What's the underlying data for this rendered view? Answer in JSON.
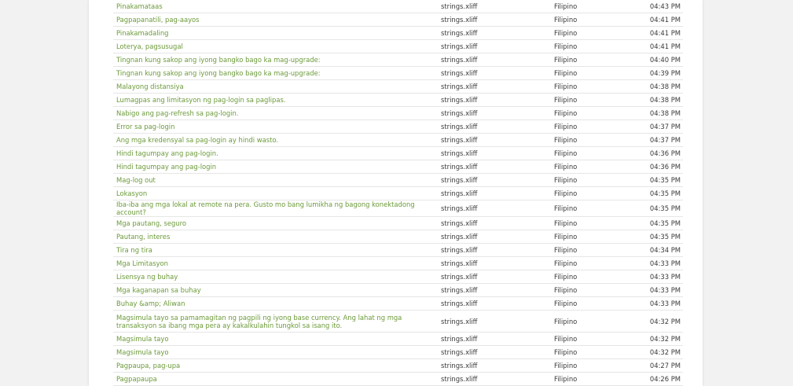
{
  "table": {
    "rows": [
      {
        "text": "Pinakamataas",
        "file": "strings.xliff",
        "language": "Filipino",
        "time": "04:43 PM"
      },
      {
        "text": "Pagpapanatili, pag-aayos",
        "file": "strings.xliff",
        "language": "Filipino",
        "time": "04:41 PM"
      },
      {
        "text": "Pinakamadaling",
        "file": "strings.xliff",
        "language": "Filipino",
        "time": "04:41 PM"
      },
      {
        "text": "Loterya, pagsusugal",
        "file": "strings.xliff",
        "language": "Filipino",
        "time": "04:41 PM"
      },
      {
        "text": "Tingnan kung sakop ang iyong bangko bago ka mag-upgrade:",
        "file": "strings.xliff",
        "language": "Filipino",
        "time": "04:40 PM"
      },
      {
        "text": "Tingnan kung sakop ang iyong bangko bago ka mag-upgrade:",
        "file": "strings.xliff",
        "language": "Filipino",
        "time": "04:39 PM"
      },
      {
        "text": "Malayong distansiya",
        "file": "strings.xliff",
        "language": "Filipino",
        "time": "04:38 PM"
      },
      {
        "text": "Lumagpas ang limitasyon ng pag-login sa paglipas.",
        "file": "strings.xliff",
        "language": "Filipino",
        "time": "04:38 PM"
      },
      {
        "text": "Nabigo ang pag-refresh sa pag-login.",
        "file": "strings.xliff",
        "language": "Filipino",
        "time": "04:38 PM"
      },
      {
        "text": "Error sa pag-login",
        "file": "strings.xliff",
        "language": "Filipino",
        "time": "04:37 PM"
      },
      {
        "text": "Ang mga kredensyal sa pag-login ay hindi wasto.",
        "file": "strings.xliff",
        "language": "Filipino",
        "time": "04:37 PM"
      },
      {
        "text": "Hindi tagumpay ang pag-login.",
        "file": "strings.xliff",
        "language": "Filipino",
        "time": "04:36 PM"
      },
      {
        "text": "Hindi tagumpay ang pag-login",
        "file": "strings.xliff",
        "language": "Filipino",
        "time": "04:36 PM"
      },
      {
        "text": "Mag-log out",
        "file": "strings.xliff",
        "language": "Filipino",
        "time": "04:35 PM"
      },
      {
        "text": "Lokasyon",
        "file": "strings.xliff",
        "language": "Filipino",
        "time": "04:35 PM"
      },
      {
        "text": "Iba-iba ang mga lokal at remote na pera. Gusto mo bang lumikha ng bagong konektadong account?",
        "file": "strings.xliff",
        "language": "Filipino",
        "time": "04:35 PM"
      },
      {
        "text": "Mga pautang, seguro",
        "file": "strings.xliff",
        "language": "Filipino",
        "time": "04:35 PM"
      },
      {
        "text": "Pautang, interes",
        "file": "strings.xliff",
        "language": "Filipino",
        "time": "04:35 PM"
      },
      {
        "text": "Tira ng tira",
        "file": "strings.xliff",
        "language": "Filipino",
        "time": "04:34 PM"
      },
      {
        "text": "Mga Limitasyon",
        "file": "strings.xliff",
        "language": "Filipino",
        "time": "04:33 PM"
      },
      {
        "text": "Lisensya ng buhay",
        "file": "strings.xliff",
        "language": "Filipino",
        "time": "04:33 PM"
      },
      {
        "text": "Mga kaganapan sa buhay",
        "file": "strings.xliff",
        "language": "Filipino",
        "time": "04:33 PM"
      },
      {
        "text": "Buhay &amp; Aliwan",
        "file": "strings.xliff",
        "language": "Filipino",
        "time": "04:33 PM"
      },
      {
        "text": "Magsimula tayo sa pamamagitan ng pagpili ng iyong base currency. Ang lahat ng mga transaksyon sa ibang mga pera ay kakalkulahin tungkol sa isang ito.",
        "file": "strings.xliff",
        "language": "Filipino",
        "time": "04:32 PM",
        "tall": true
      },
      {
        "text": "Magsimula tayo",
        "file": "strings.xliff",
        "language": "Filipino",
        "time": "04:32 PM"
      },
      {
        "text": "Magsimula tayo",
        "file": "strings.xliff",
        "language": "Filipino",
        "time": "04:32 PM"
      },
      {
        "text": "Pagpaupa, pag-upa",
        "file": "strings.xliff",
        "language": "Filipino",
        "time": "04:27 PM"
      },
      {
        "text": "Pagpapaupa",
        "file": "strings.xliff",
        "language": "Filipino",
        "time": "04:26 PM"
      }
    ]
  },
  "colors": {
    "link": "#6c9a3a",
    "text": "#3a3a3a",
    "background": "#f2f2f2",
    "panel": "#ffffff",
    "row_border": "#e6e6e6"
  }
}
